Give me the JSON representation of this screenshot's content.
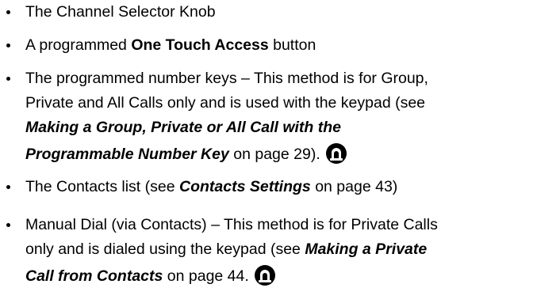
{
  "items": [
    {
      "lines": [
        {
          "t1": "The Channel Selector Knob"
        }
      ]
    },
    {
      "lines": [
        {
          "t1": "A programmed ",
          "b1": "One Touch Access",
          "t2": " button"
        }
      ]
    },
    {
      "lines": [
        {
          "t1": "The programmed number keys – This method is for Group,"
        },
        {
          "t1": "Private and All Calls only and is used with the keypad (see"
        },
        {
          "bi1": "Making a Group, Private or All Call with the"
        },
        {
          "bi1": "Programmable Number Key",
          "t2": " on page 29)."
        }
      ]
    },
    {
      "lines": [
        {
          "t1": "The Contacts list (see ",
          "bi1": "Contacts Settings",
          "t2": " on page 43)"
        }
      ]
    },
    {
      "lines": [
        {
          "t1": "Manual Dial (via Contacts) – This method is for Private Calls"
        },
        {
          "t1": "only and is dialed using the keypad (see ",
          "bi1": "Making a Private"
        },
        {
          "bi1": "Call from Contacts",
          "t2": " on page 44."
        }
      ]
    }
  ],
  "icons": {
    "keypad_icon": "keypad-mic-icon",
    "color": "#000000"
  }
}
